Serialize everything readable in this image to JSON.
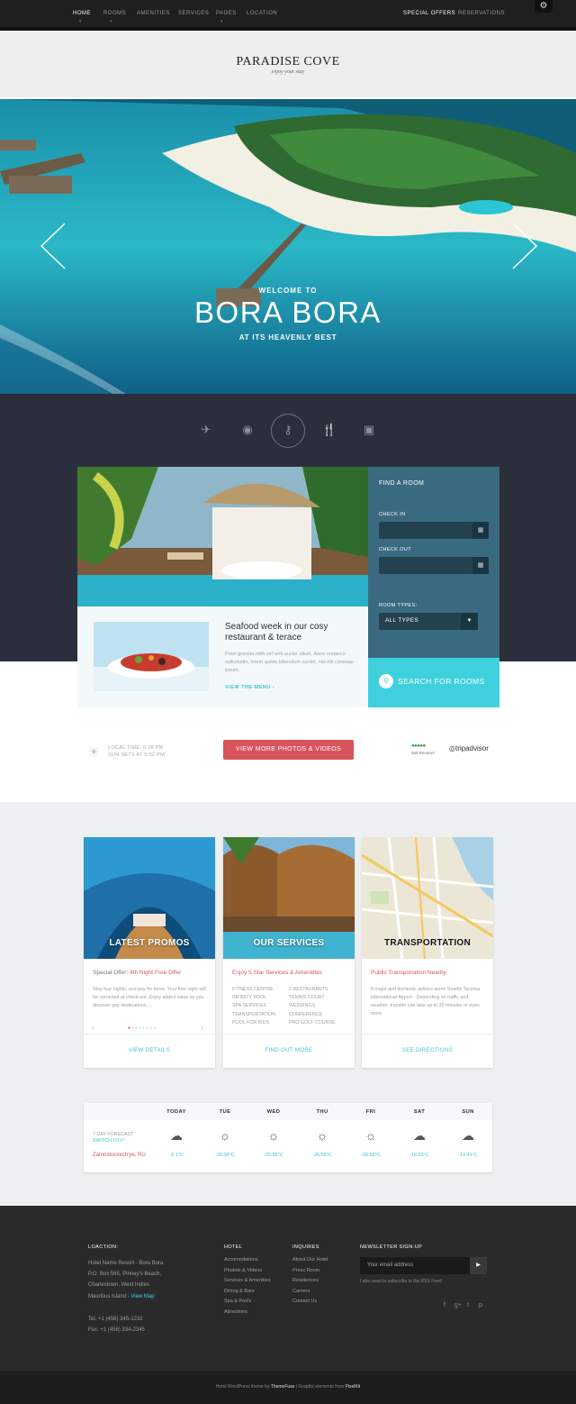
{
  "nav": {
    "left": [
      "HOME",
      "ROOMS",
      "AMENITIES",
      "SERVICES",
      "PAGES",
      "LOCATION"
    ],
    "right": [
      "SPECIAL OFFERS",
      "RESERVATIONS"
    ]
  },
  "logo": {
    "title": "PARADISE COVE",
    "tagline": "enjoy your stay"
  },
  "hero": {
    "welcome": "WELCOME TO",
    "title": "BORA BORA",
    "subtitle": "AT ITS HEAVENLY BEST"
  },
  "promo": {
    "title": "Seafood week in our cosy restaurant & terace",
    "text": "Proin gravida nibh vel velit auctor aliuet. Aene restanco sollicitudin, lorem quiste bibendum auctor, nisi elit consequ ipsum.",
    "link": "VIEW THE MENU"
  },
  "finder": {
    "title": "FIND A ROOM",
    "check_in": "CHECK IN",
    "check_out": "CHECK OUT",
    "room_types": "ROOM TYPES:",
    "room_value": "ALL TYPES",
    "search": "SEARCH FOR ROOMS"
  },
  "info": {
    "local_time": "LOCAL TIME: 6:28 PM",
    "sun_sets": "SUN SETS AT 5:52 PM",
    "more_button": "VIEW MORE PHOTOS & VIDEOS",
    "reviews": "568 Reviews",
    "tripadvisor": "tripadvisor"
  },
  "cards": [
    {
      "title": "LATEST PROMOS",
      "subtitle_prefix": "Special Offer: ",
      "subtitle": "4th Night Free Offer",
      "text": "Stay four nights, and pay for three. Your free night will be corrected at check-out. Enjoy added value as you discover gay destinations, ...",
      "link": "VIEW DETAILS"
    },
    {
      "title": "OUR SERVICES",
      "subtitle": "Enjoy 5 Star Services & Amenitites",
      "col1": [
        "FITNESS CENTRE",
        "INFINITY POOL",
        "SPA SERVICES",
        "TRANSPORTATION",
        "POOL FOR KIDS"
      ],
      "col2": [
        "2 RESTAURANTS",
        "TENNIS COURT",
        "WEDDINGS",
        "CONFERENCE",
        "PRO GOLF COURSE"
      ],
      "link": "FIND OUT MORE"
    },
    {
      "title": "TRANSPORTATION",
      "subtitle": "Public Transportation Nearby",
      "text": "8 major and domestic airlines serve Seattle Tacoma International Airport - Depending on traffic and weather, transfer can take up to 30 minutes or even more.",
      "link": "SEE DIRECTIONS"
    }
  ],
  "weather": {
    "forecast": "7 DAY FORECAST",
    "switch": "SWITCH TO F°",
    "location": "Zamoskvorech'ye, RU",
    "days": [
      {
        "day": "TODAY",
        "icon": "snow-cloud",
        "temp": "-9.1°C"
      },
      {
        "day": "TUE",
        "icon": "sun",
        "temp": "-20.34°C"
      },
      {
        "day": "WED",
        "icon": "sun",
        "temp": "-25.85°C"
      },
      {
        "day": "THU",
        "icon": "sun",
        "temp": "-26.59°C"
      },
      {
        "day": "FRI",
        "icon": "sun",
        "temp": "-20.59°C"
      },
      {
        "day": "SAT",
        "icon": "snow-cloud",
        "temp": "-16.03°C"
      },
      {
        "day": "SUN",
        "icon": "snow-cloud",
        "temp": "-13.41°C"
      }
    ]
  },
  "footer": {
    "location_head": "LOACTION:",
    "address": [
      "Hotel Name Resort - Bora Bora",
      "P.O. Box 565, Pinney's Beach,",
      "Charlestown, West Indies"
    ],
    "address_last": "Mauritius Island - ",
    "view_map": "View Map",
    "tel": "Tel. +1 (456) 345-1232",
    "fax": "Fax. +1 (456) 334-2345",
    "hotel_head": "HOTEL",
    "hotel_links": [
      "Accomodations",
      "Photots & Videos",
      "Services & Amenities",
      "Dining & Bars",
      "Spa & Pools",
      "Attractions"
    ],
    "inquires_head": "INQUIRES",
    "inquires_links": [
      "About Our Hotel",
      "Press Room",
      "Residences",
      "Careers",
      "Contact Us"
    ],
    "newsletter_head": "NEWSLETTER SIGN-UP",
    "newsletter_placeholder": "Your email address",
    "newsletter_note": "I also want to subscribe to the RSS Feed",
    "copyright_a": "Hotel WordPress theme by ",
    "copyright_b": "ThemeFuse",
    "copyright_c": " | Graphic elements from ",
    "copyright_d": "PixelKit"
  },
  "colors": {
    "accent": "#3fd0de",
    "red": "#d9535d",
    "dark": "#2b2f3c",
    "finder": "#3a6a7f"
  }
}
